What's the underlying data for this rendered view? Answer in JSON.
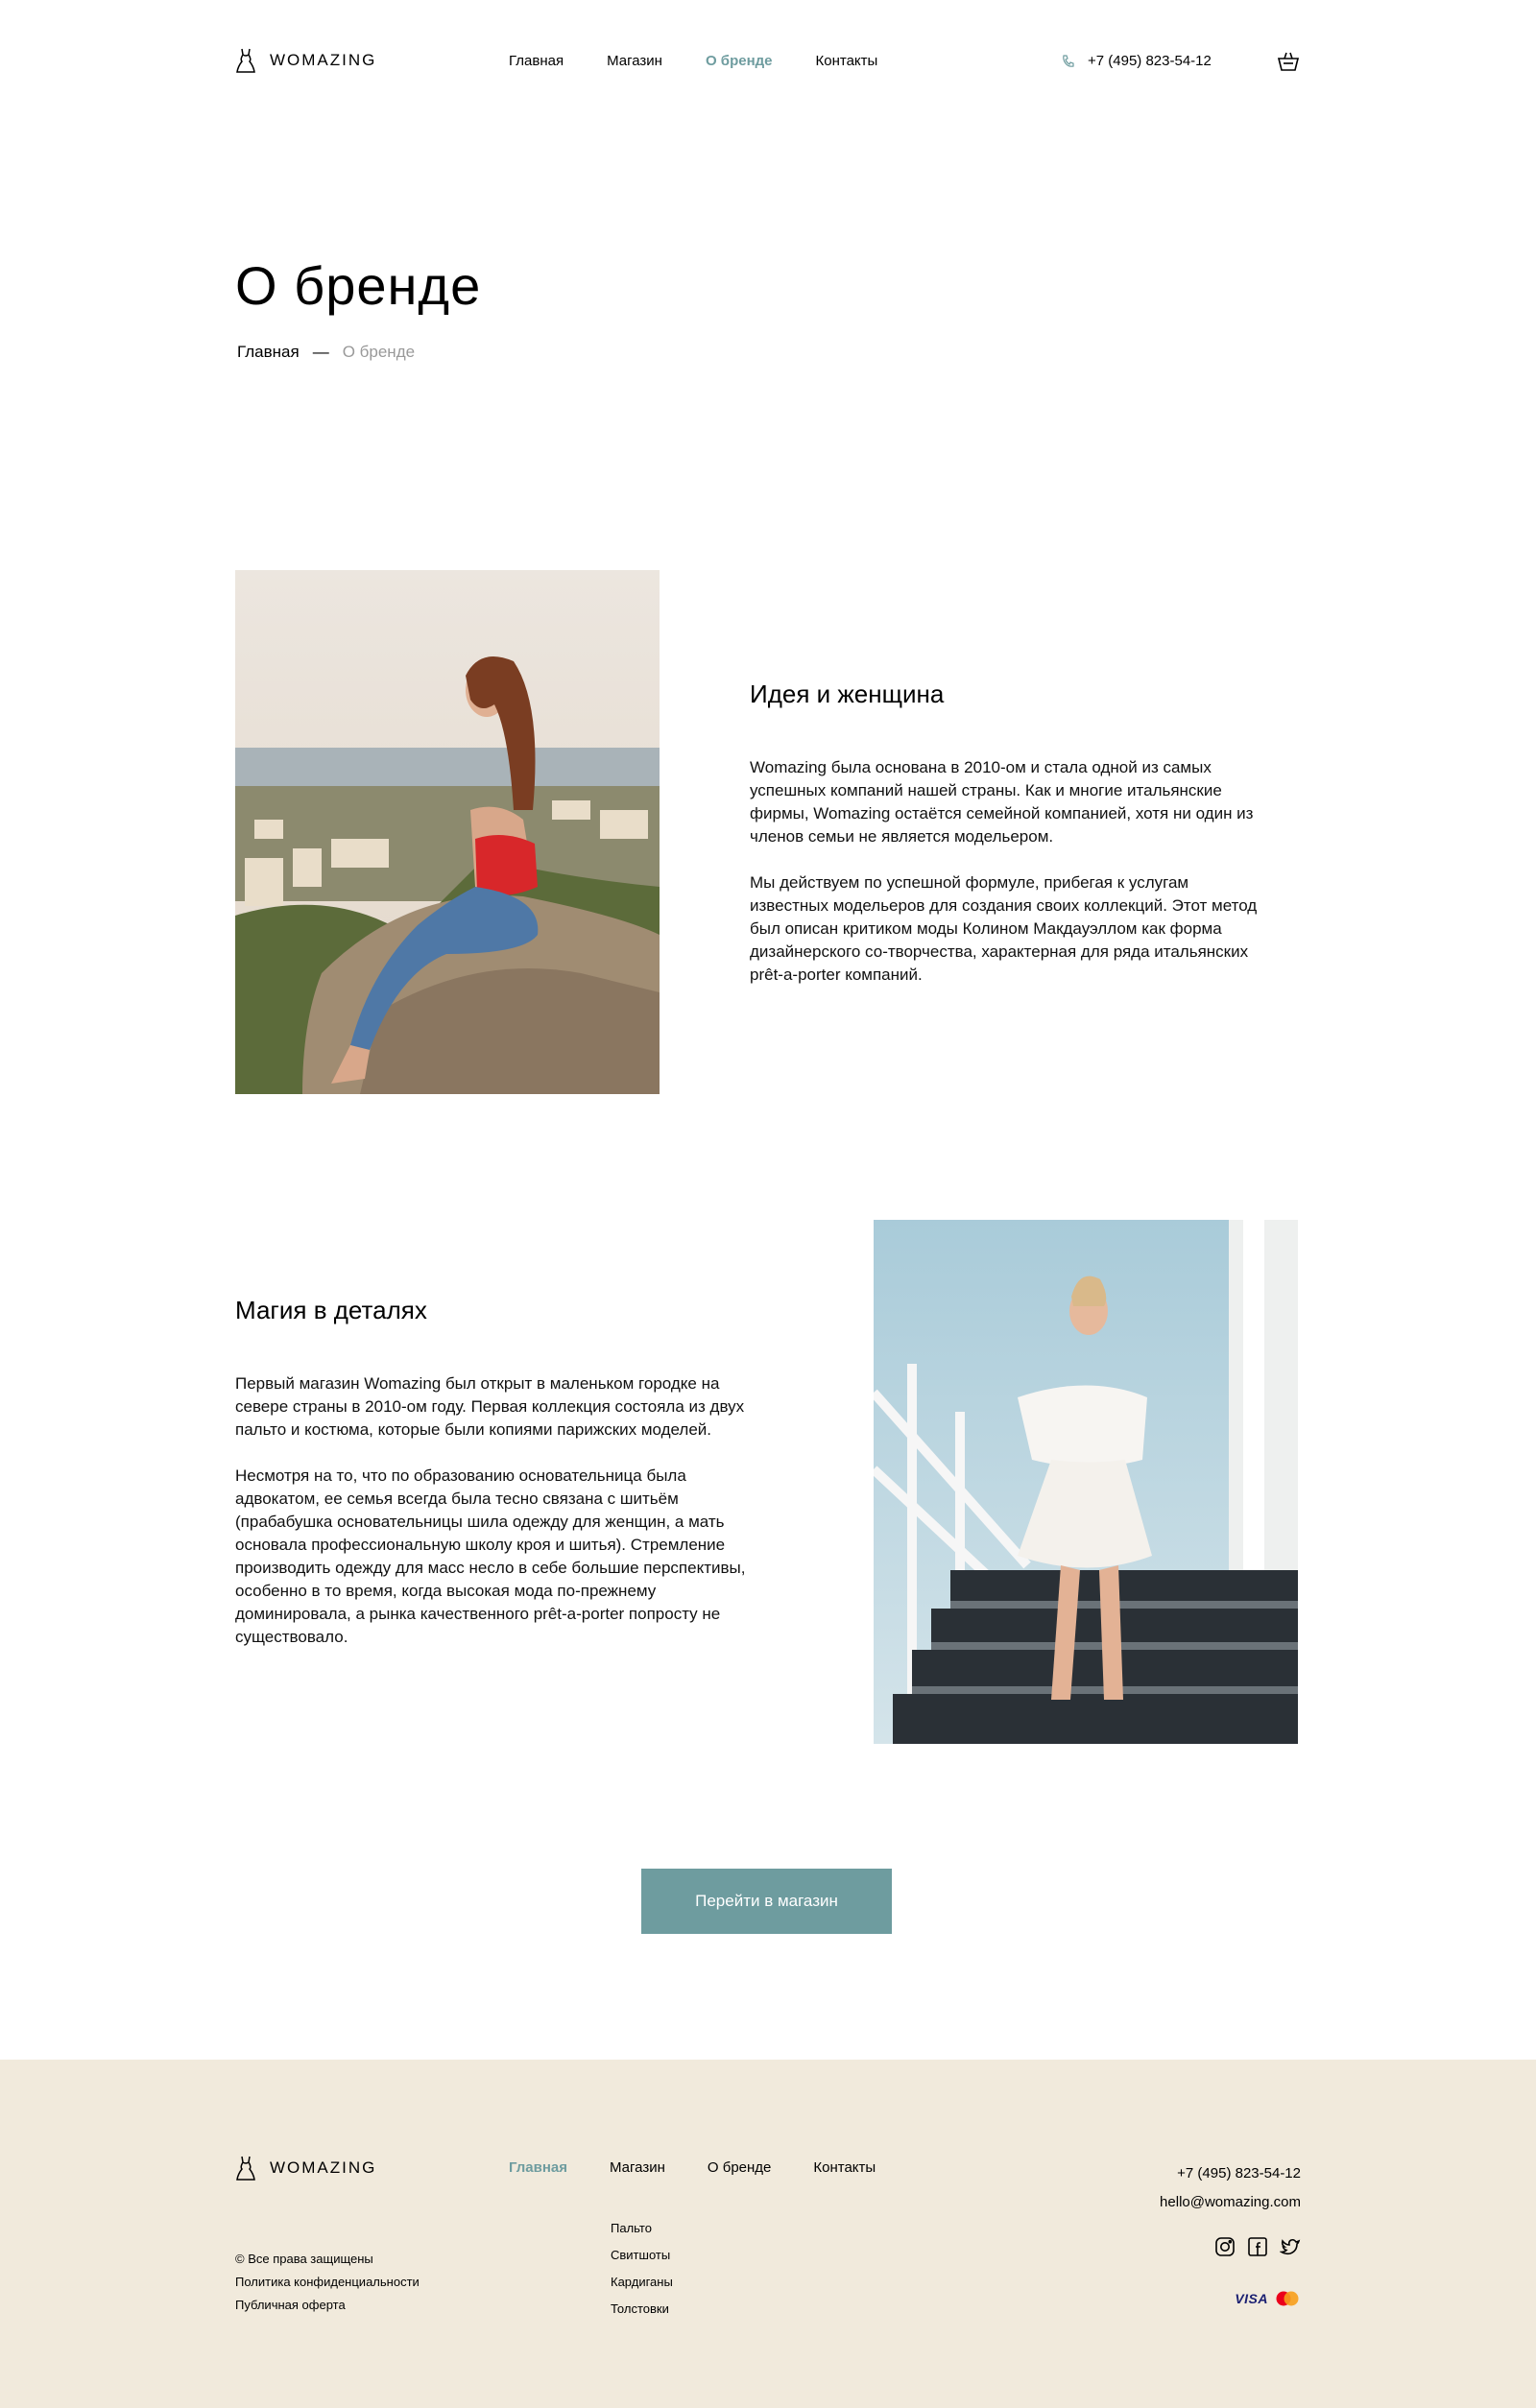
{
  "header": {
    "logo_text": "WOMAZING",
    "nav": [
      {
        "label": "Главная",
        "active": false
      },
      {
        "label": "Магазин",
        "active": false
      },
      {
        "label": "О бренде",
        "active": true
      },
      {
        "label": "Контакты",
        "active": false
      }
    ],
    "phone": "+7 (495) 823-54-12",
    "phone_icon": "phone-icon",
    "cart_icon": "cart-icon"
  },
  "page": {
    "title": "О бренде",
    "breadcrumb": {
      "home": "Главная",
      "separator": "—",
      "current": "О бренде"
    }
  },
  "sections": [
    {
      "title": "Идея и женщина",
      "paragraphs": [
        "Womazing была основана в 2010-ом и стала одной из самых успешных компаний нашей страны. Как и многие итальянские фирмы, Womazing остаётся семейной компанией, хотя ни один из членов семьи не является модельером.",
        "Мы действуем по успешной формуле, прибегая к услугам известных модельеров для создания своих коллекций. Этот метод был описан критиком моды Колином Макдауэллом как форма дизайнерского со-творчества, характерная для ряда итальянских prêt-a-porter компаний."
      ]
    },
    {
      "title": "Магия в деталях",
      "paragraphs": [
        "Первый магазин Womazing был открыт в маленьком городке на севере страны в 2010-ом году. Первая коллекция состояла из двух пальто и костюма, которые были копиями парижских моделей.",
        "Несмотря на то, что по образованию основательница была адвокатом, ее семья всегда была тесно связана с шитьём (прабабушка основательницы шила одежду для женщин, а мать основала профессиональную школу кроя и шитья). Стремление производить одежду для масс несло в себе большие перспективы, особенно в то время, когда высокая мода по-прежнему доминировала, а рынка качественного prêt-a-porter попросту не существовало."
      ]
    }
  ],
  "cta": {
    "label": "Перейти в магазин"
  },
  "footer": {
    "logo_text": "WOMAZING",
    "nav": [
      {
        "label": "Главная",
        "active": true
      },
      {
        "label": "Магазин",
        "active": false
      },
      {
        "label": "О бренде",
        "active": false
      },
      {
        "label": "Контакты",
        "active": false
      }
    ],
    "shop_links": [
      "Пальто",
      "Свитшоты",
      "Кардиганы",
      "Толстовки"
    ],
    "legal": [
      "© Все права защищены",
      "Политика конфиденциальности",
      "Публичная оферта"
    ],
    "phone": "+7 (495) 823-54-12",
    "email": "hello@womazing.com",
    "social_icons": [
      "instagram-icon",
      "facebook-icon",
      "twitter-icon"
    ],
    "payment": {
      "visa": "VISA",
      "mastercard_icon": "mastercard-icon"
    }
  },
  "colors": {
    "accent": "#6e9c9f",
    "footer_bg": "#f1eadc"
  }
}
